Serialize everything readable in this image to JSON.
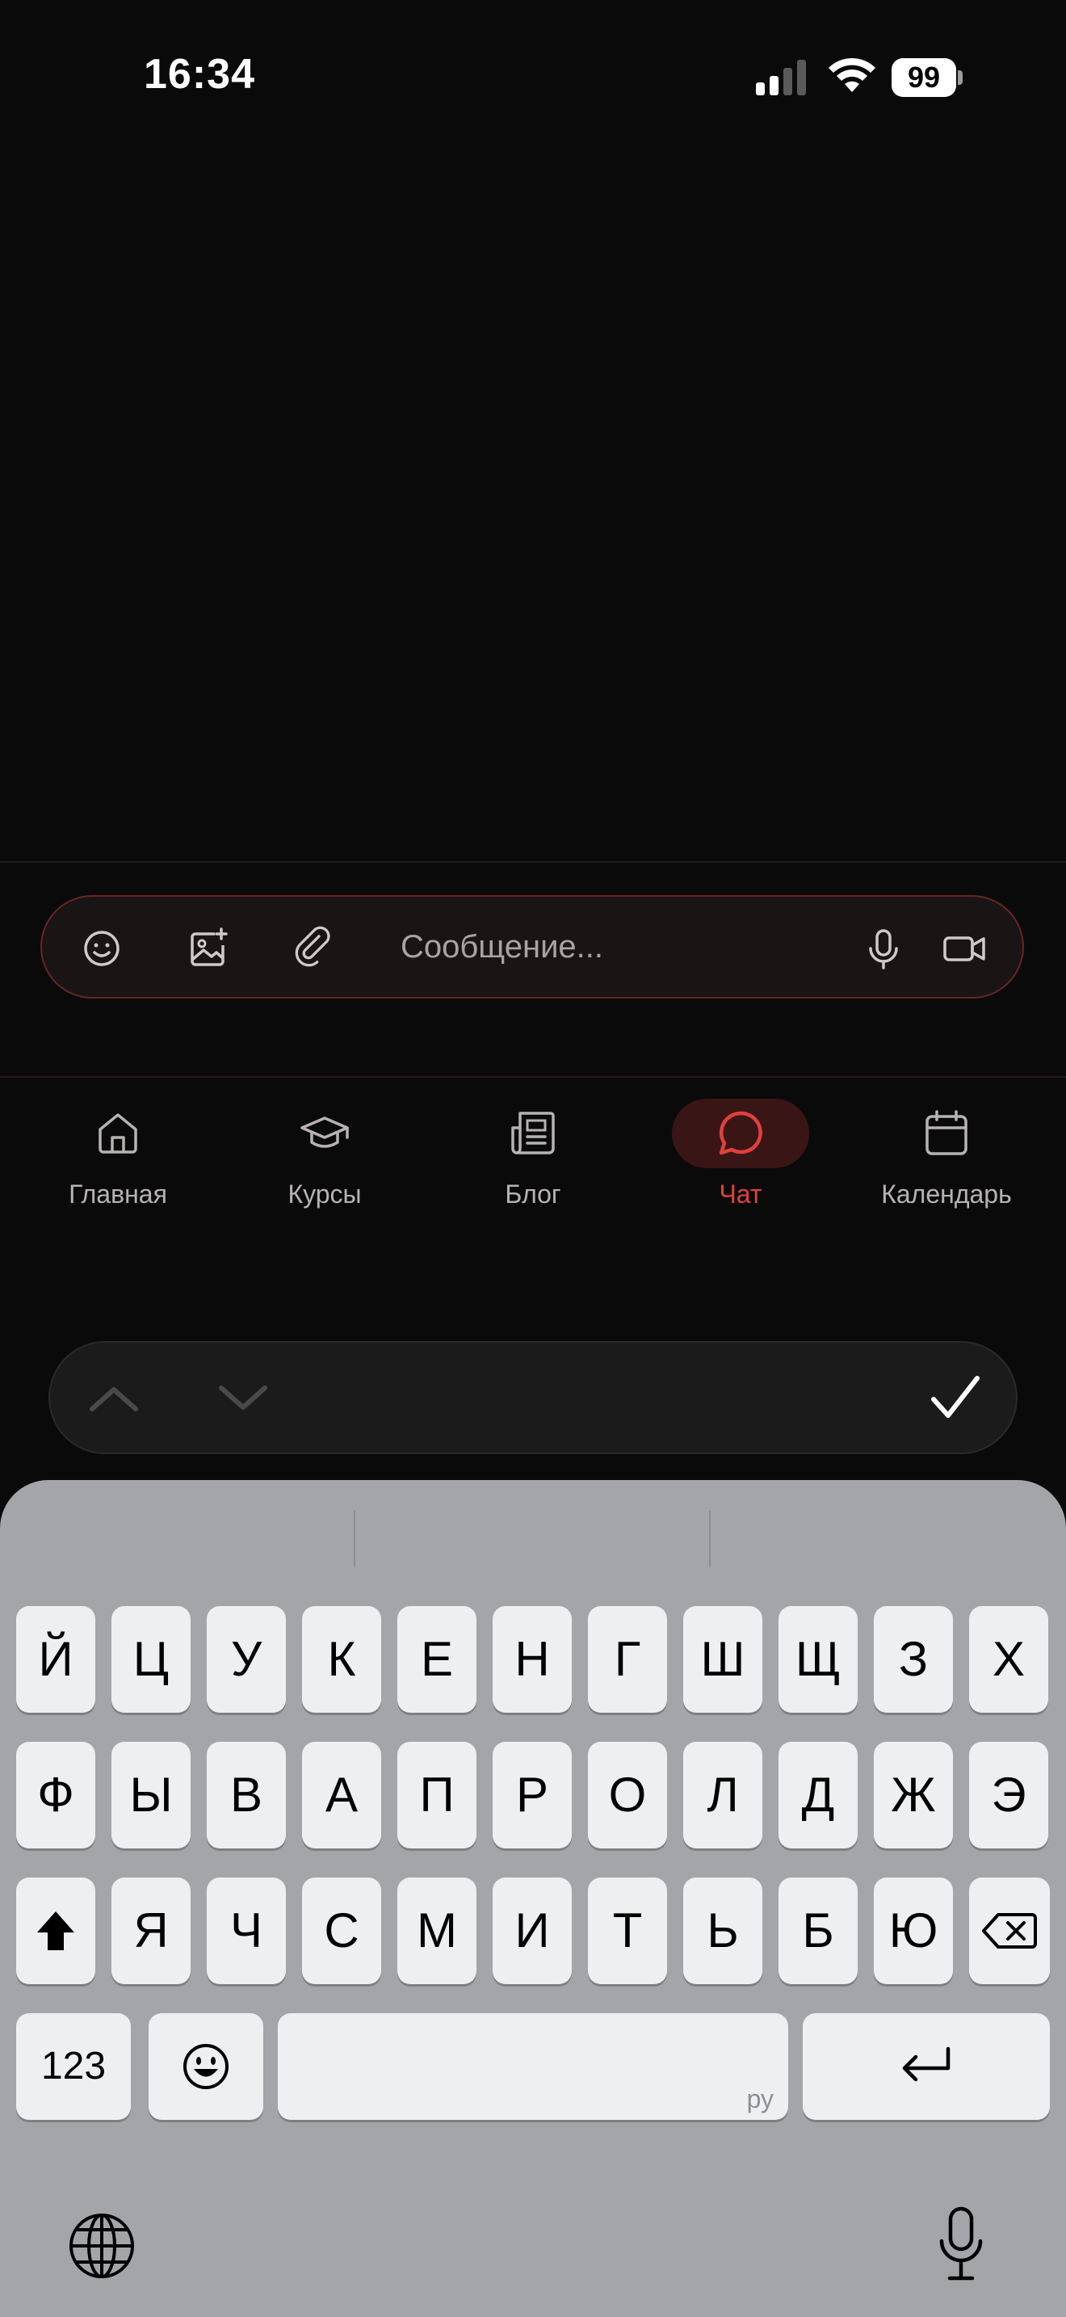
{
  "status_bar": {
    "time": "16:34",
    "battery": "99"
  },
  "composer": {
    "placeholder": "Сообщение..."
  },
  "tabs": [
    {
      "label": "Главная",
      "icon": "home-icon"
    },
    {
      "label": "Курсы",
      "icon": "graduation-cap-icon"
    },
    {
      "label": "Блог",
      "icon": "newspaper-icon"
    },
    {
      "label": "Чат",
      "icon": "chat-bubble-icon",
      "active": true
    },
    {
      "label": "Календарь",
      "icon": "calendar-icon"
    }
  ],
  "accent_color": "#e0413d",
  "keyboard": {
    "row1": [
      "Й",
      "Ц",
      "У",
      "К",
      "Е",
      "Н",
      "Г",
      "Ш",
      "Щ",
      "З",
      "Х"
    ],
    "row2": [
      "Ф",
      "Ы",
      "В",
      "А",
      "П",
      "Р",
      "О",
      "Л",
      "Д",
      "Ж",
      "Э"
    ],
    "row3": [
      "Я",
      "Ч",
      "С",
      "М",
      "И",
      "Т",
      "Ь",
      "Б",
      "Ю"
    ],
    "numbers_label": "123",
    "space_lang": "ру"
  }
}
